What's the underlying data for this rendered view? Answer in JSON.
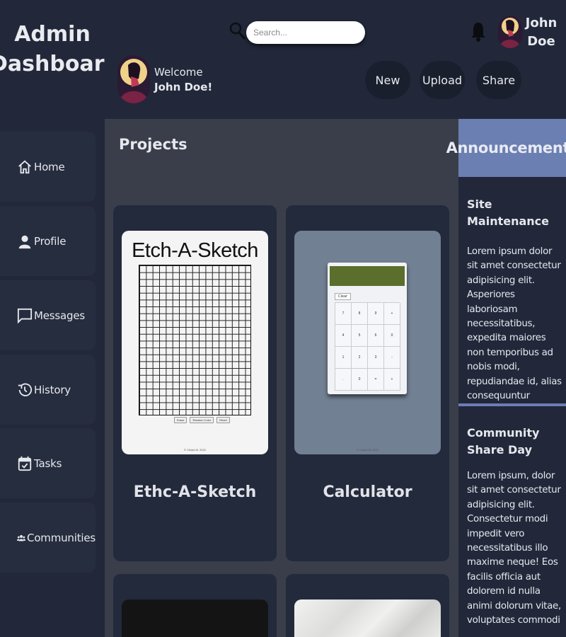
{
  "brand": {
    "line1": "Admin",
    "line2": "Dashboard"
  },
  "sidebar": {
    "items": [
      {
        "label": "Home",
        "icon": "home-icon"
      },
      {
        "label": "Profile",
        "icon": "user-icon"
      },
      {
        "label": "Messages",
        "icon": "message-icon"
      },
      {
        "label": "History",
        "icon": "history-icon"
      },
      {
        "label": "Tasks",
        "icon": "calendar-icon"
      },
      {
        "label": "Communities",
        "icon": "group-icon"
      }
    ]
  },
  "header": {
    "search_placeholder": "Search...",
    "user_first": "John",
    "user_last": "Doe",
    "welcome_label": "Welcome",
    "welcome_name": "John Doe!",
    "buttons": {
      "new": "New",
      "upload": "Upload",
      "share": "Share"
    }
  },
  "main": {
    "title": "Projects",
    "cards": [
      {
        "title": "Ethc-A-Sketch",
        "preview_heading": "Etch-A-Sketch",
        "preview_buttons": [
          "Erase",
          "Random Color",
          "Reset"
        ],
        "preview_footer": "© Chidoi M. 2022"
      },
      {
        "title": "Calculator",
        "preview_clear": "Clear",
        "preview_keys": [
          "7",
          "8",
          "9",
          "+",
          "4",
          "5",
          "6",
          "X",
          "1",
          "2",
          "3",
          "-",
          ".",
          "0",
          "=",
          "+"
        ],
        "preview_footer": "© Chidoi M. 2022"
      }
    ]
  },
  "announcements": {
    "heading": "Announcements",
    "items": [
      {
        "title": "Site Maintenance",
        "body": "Lorem ipsum dolor sit amet consectetur adipisicing elit. Asperiores laboriosam necessitatibus, expedita maiores non temporibus ad nobis modi, repudiandae id, alias consequuntur dolores labore! Error ratione ex recusandae voluptatem dolor."
      },
      {
        "title": "Community Share Day",
        "body": "Lorem ipsum, dolor sit amet consectetur adipisicing elit. Consectetur modi impedit vero necessitatibus illo maxime neque! Eos facilis officia aut dolorem id nulla animi dolorum vitae, voluptates commodi"
      }
    ]
  },
  "colors": {
    "accent": "#6b7fb3",
    "sidebar": "#222839",
    "main_bg": "#3a3e4b",
    "card": "#232a3c"
  }
}
